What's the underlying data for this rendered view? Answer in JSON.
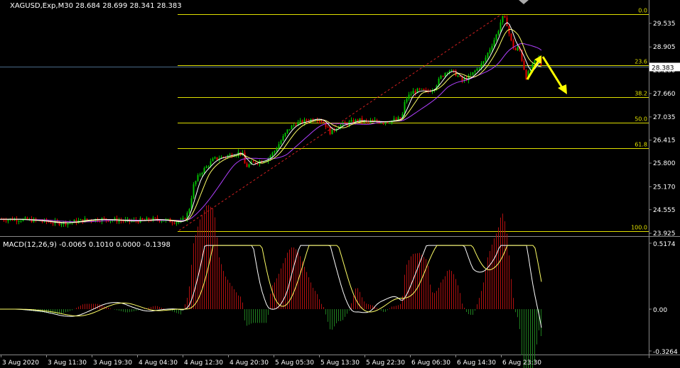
{
  "header": {
    "symbol_info": "XAGUSD,Exp,M30  28.684 28.699 28.341 28.383"
  },
  "macd_header": "MACD(12,26,9) -0.0065 0.1010 0.0000 -0.1398",
  "price_axis": {
    "ticks": [
      "29.535",
      "28.905",
      "28.280",
      "27.660",
      "27.035",
      "26.415",
      "25.800",
      "25.170",
      "24.555",
      "23.925"
    ],
    "current_price": "28.383"
  },
  "macd_axis": {
    "ticks": [
      "0.5174",
      "0.00",
      "-0.3264"
    ]
  },
  "fib_levels": [
    "0.0",
    "23.6",
    "38.2",
    "50.0",
    "61.8",
    "100.0"
  ],
  "time_axis": {
    "labels": [
      "3 Aug 2020",
      "3 Aug 11:30",
      "3 Aug 19:30",
      "4 Aug 04:30",
      "4 Aug 12:30",
      "4 Aug 20:30",
      "5 Aug 05:30",
      "5 Aug 13:30",
      "5 Aug 22:30",
      "6 Aug 06:30",
      "6 Aug 14:30",
      "6 Aug 23:30"
    ]
  },
  "colors": {
    "background": "#000000",
    "fib": "#e0e000",
    "bull_candle": "#00c000",
    "bear_candle": "#e00000",
    "ma_fast": "#ffffff",
    "ma_mid": "#ffff66",
    "ma_slow": "#b040ff",
    "ma_long": "#60c060",
    "trendline": "#d02020",
    "arrow": "#ffff00",
    "hist_pos": "#b01010",
    "hist_neg": "#208020"
  },
  "chart_data": {
    "type": "candlestick",
    "symbol": "XAGUSD,Exp",
    "timeframe": "M30",
    "ohlc_last": {
      "open": 28.684,
      "high": 28.699,
      "low": 28.341,
      "close": 28.383
    },
    "price_range": [
      23.925,
      29.9
    ],
    "close_path": [
      [
        0,
        24.3
      ],
      [
        20,
        24.3
      ],
      [
        40,
        24.28
      ],
      [
        60,
        24.25
      ],
      [
        80,
        24.2
      ],
      [
        100,
        24.22
      ],
      [
        120,
        24.28
      ],
      [
        140,
        24.3
      ],
      [
        160,
        24.28
      ],
      [
        180,
        24.25
      ],
      [
        200,
        24.27
      ],
      [
        220,
        24.3
      ],
      [
        240,
        24.25
      ],
      [
        255,
        24.22
      ],
      [
        265,
        24.5
      ],
      [
        272,
        25.2
      ],
      [
        280,
        25.5
      ],
      [
        290,
        25.7
      ],
      [
        300,
        25.9
      ],
      [
        310,
        25.95
      ],
      [
        320,
        26.0
      ],
      [
        330,
        26.05
      ],
      [
        340,
        26.1
      ],
      [
        345,
        25.7
      ],
      [
        355,
        25.8
      ],
      [
        365,
        25.85
      ],
      [
        375,
        25.9
      ],
      [
        385,
        26.1
      ],
      [
        395,
        26.4
      ],
      [
        405,
        26.7
      ],
      [
        415,
        26.85
      ],
      [
        425,
        26.9
      ],
      [
        435,
        26.95
      ],
      [
        445,
        27.0
      ],
      [
        455,
        26.9
      ],
      [
        465,
        26.6
      ],
      [
        475,
        26.8
      ],
      [
        485,
        26.85
      ],
      [
        495,
        26.9
      ],
      [
        505,
        26.95
      ],
      [
        515,
        26.9
      ],
      [
        525,
        26.92
      ],
      [
        540,
        26.9
      ],
      [
        555,
        26.95
      ],
      [
        565,
        27.0
      ],
      [
        570,
        27.5
      ],
      [
        580,
        27.7
      ],
      [
        590,
        27.75
      ],
      [
        600,
        27.7
      ],
      [
        610,
        27.8
      ],
      [
        620,
        28.1
      ],
      [
        630,
        28.3
      ],
      [
        640,
        28.2
      ],
      [
        650,
        28.0
      ],
      [
        660,
        28.1
      ],
      [
        670,
        28.3
      ],
      [
        680,
        28.5
      ],
      [
        690,
        28.9
      ],
      [
        700,
        29.3
      ],
      [
        706,
        29.7
      ],
      [
        712,
        29.6
      ],
      [
        718,
        29.1
      ],
      [
        724,
        28.8
      ],
      [
        730,
        28.9
      ],
      [
        736,
        28.4
      ],
      [
        740,
        28.1
      ],
      [
        746,
        28.3
      ],
      [
        752,
        28.5
      ],
      [
        758,
        28.6
      ],
      [
        762,
        28.38
      ]
    ],
    "fib_retracement": [
      {
        "level": "0.0",
        "price": 29.78
      },
      {
        "level": "23.6",
        "price": 28.41
      },
      {
        "level": "38.2",
        "price": 27.56
      },
      {
        "level": "50.0",
        "price": 26.88
      },
      {
        "level": "61.8",
        "price": 26.19
      },
      {
        "level": "100.0",
        "price": 23.98
      }
    ],
    "macd": {
      "params": "12,26,9",
      "main": -0.0065,
      "signal": 0.101,
      "range": [
        -0.3264,
        0.5174
      ]
    }
  }
}
